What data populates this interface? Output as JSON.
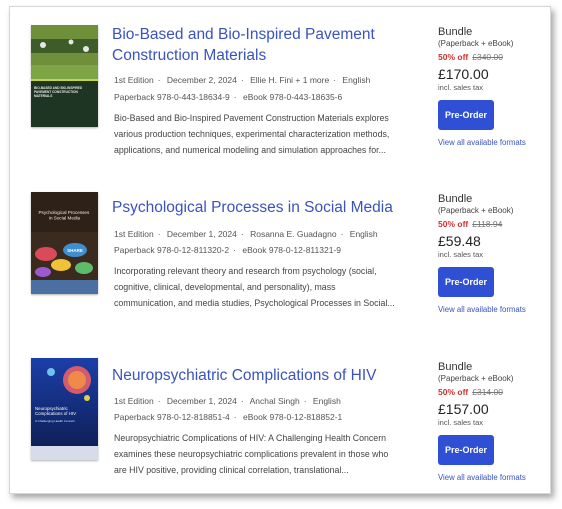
{
  "items": [
    {
      "title_line1": "Bio-Based and Bio-Inspired Pavement",
      "title_line2": "Construction Materials",
      "edition": "1st Edition",
      "date": "December 2, 2024",
      "author": "Ellie H. Fini + 1 more",
      "language": "English",
      "paperback": "Paperback 978-0-443-18634-9",
      "ebook": "eBook 978-0-443-18635-6",
      "desc_line1": "Bio-Based and Bio-Inspired Pavement Construction Materials explores",
      "desc_line2": "various production techniques, experimental characterization methods,",
      "desc_line3": "applications, and numerical modeling and simulation approaches for...",
      "bundle": "Bundle",
      "bundle_sub": "(Paperback + eBook)",
      "discount": "50% off",
      "old_price": "£340.00",
      "price": "£170.00",
      "tax": "incl. sales tax",
      "button": "Pre-Order",
      "formats_link": "View all available formats",
      "cover_title": "BIO-BASED AND BIO-INSPIRED PAVEMENT CONSTRUCTION MATERIALS"
    },
    {
      "title_line1": "Psychological Processes in Social Media",
      "edition": "1st Edition",
      "date": "December 1, 2024",
      "author": "Rosanna E. Guadagno",
      "language": "English",
      "paperback": "Paperback 978-0-12-811320-2",
      "ebook": "eBook 978-0-12-811321-9",
      "desc_line1": "Incorporating relevant theory and research from psychology (social,",
      "desc_line2": "cognitive, clinical, developmental, and personality), mass",
      "desc_line3": "communication, and media studies, Psychological Processes in Social...",
      "bundle": "Bundle",
      "bundle_sub": "(Paperback + eBook)",
      "discount": "50% off",
      "old_price": "£118.94",
      "price": "£59.48",
      "tax": "incl. sales tax",
      "button": "Pre-Order",
      "formats_link": "View all available formats",
      "cover_title": "Psychological Processes in Social Media",
      "cover_bubble": "SHARE"
    },
    {
      "title_line1": "Neuropsychiatric Complications of HIV",
      "edition": "1st Edition",
      "date": "December 1, 2024",
      "author": "Anchal Singh",
      "language": "English",
      "paperback": "Paperback 978-0-12-818851-4",
      "ebook": "eBook 978-0-12-818852-1",
      "desc_line1": "Neuropsychiatric Complications of HIV: A Challenging Health Concern",
      "desc_line2": "examines these neuropsychiatric complications prevalent in those who",
      "desc_line3": "are HIV positive, providing clinical correlation, translational...",
      "bundle": "Bundle",
      "bundle_sub": "(Paperback + eBook)",
      "discount": "50% off",
      "old_price": "£314.00",
      "price": "£157.00",
      "tax": "incl. sales tax",
      "button": "Pre-Order",
      "formats_link": "View all available formats",
      "cover_title": "Neuropsychiatric Complications of HIV",
      "cover_subtitle": "A Challenging Health Concern"
    }
  ],
  "colors": {
    "title_link": "#3a53bf",
    "button": "#2f4fd4",
    "discount": "#d0322e"
  }
}
